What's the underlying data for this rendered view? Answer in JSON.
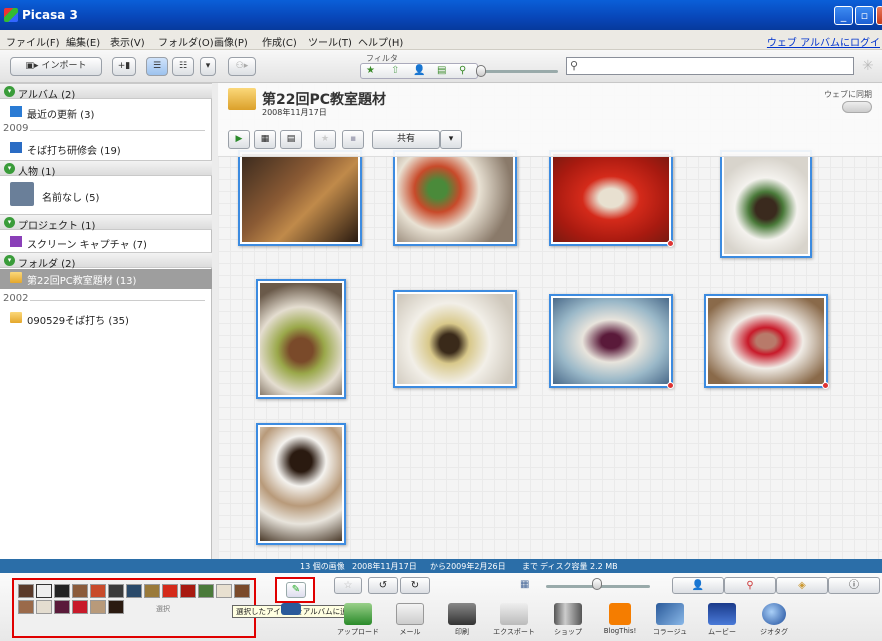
{
  "window": {
    "title": "Picasa 3"
  },
  "menu": {
    "items": [
      "ファイル(F)",
      "編集(E)",
      "表示(V)",
      "フォルダ(O)",
      "画像(P)",
      "作成(C)",
      "ツール(T)",
      "ヘルプ(H)"
    ],
    "web_link": "ウェブ アルバムにログイ"
  },
  "toolbar": {
    "import_label": "インポート",
    "filter_label": "フィルタ",
    "search_icon": "magnifier-icon"
  },
  "sidebar": {
    "albums_header": "アルバム (2)",
    "recent_updates": "最近の更新 (3)",
    "year_2009": "2009",
    "soba_training": "そば打ち研修会 (19)",
    "people_header": "人物 (1)",
    "unnamed": "名前なし (5)",
    "projects_header": "プロジェクト (1)",
    "screen_capture": "スクリーン キャプチャ (7)",
    "folders_header": "フォルダ (2)",
    "pc_class": "第22回PC教室題材 (13)",
    "year_2002": "2002",
    "soba_folder": "090529そば打ち (35)"
  },
  "album": {
    "title": "第22回PC教室題材",
    "date": "2008年11月17日",
    "sync_label": "ウェブに同期",
    "share_label": "共有"
  },
  "status": {
    "count": "13 個の画像",
    "from_date": "2008年11月17日",
    "from": "から",
    "to_date": "2009年2月26日",
    "to": "まで",
    "disk": "ディスク容量 2.2 MB"
  },
  "tray": {
    "caption": "選択"
  },
  "tooltip": "選択したアイテムをアルバムに追加",
  "actions": [
    "アップロード",
    "メール",
    "印刷",
    "エクスポート",
    "ショップ",
    "BlogThis!",
    "コラージュ",
    "ムービー",
    "ジオタグ"
  ],
  "colors": {
    "accent": "#3c8be0",
    "titlebar": "#0846b8",
    "statusbar": "#2b6ea8",
    "highlight": "#e00000"
  }
}
